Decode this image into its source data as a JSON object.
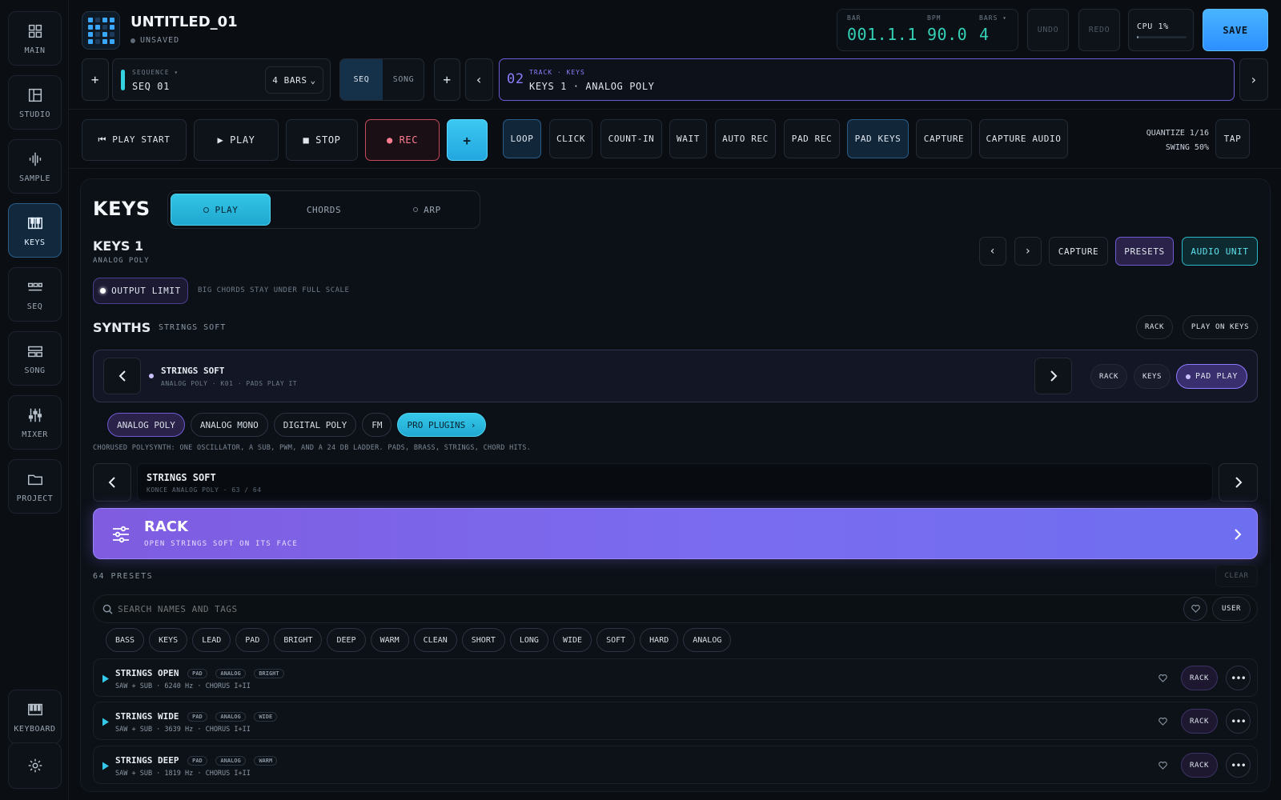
{
  "sidebar": {
    "items": [
      {
        "label": "MAIN",
        "icon": "grid-icon"
      },
      {
        "label": "STUDIO",
        "icon": "layout-icon"
      },
      {
        "label": "SAMPLE",
        "icon": "waveform-icon"
      },
      {
        "label": "KEYS",
        "icon": "piano-icon"
      },
      {
        "label": "SEQ",
        "icon": "steps-icon"
      },
      {
        "label": "SONG",
        "icon": "blocks-icon"
      },
      {
        "label": "MIXER",
        "icon": "faders-icon"
      },
      {
        "label": "PROJECT",
        "icon": "folder-icon"
      }
    ],
    "keyboard_label": "KEYBOARD",
    "active": "KEYS"
  },
  "header": {
    "project_title": "UNTITLED_01",
    "status": "UNSAVED",
    "bar_label": "BAR",
    "bar_value": "001.1.1",
    "bpm_label": "BPM",
    "bpm_value": "90.0",
    "bars_label": "BARS ▾",
    "bars_value": "4",
    "undo": "UNDO",
    "redo": "REDO",
    "cpu": "CPU 1%",
    "cpu_level": 0.01,
    "save": "SAVE"
  },
  "sequence_bar": {
    "add": "+",
    "sequence_label": "SEQUENCE ▾",
    "sequence_name": "SEQ 01",
    "length": "4 BARS",
    "mode_seq": "SEQ",
    "mode_song": "SONG",
    "add2": "+",
    "prev": "‹",
    "track_number": "02",
    "track_label": "TRACK · KEYS",
    "track_name": "KEYS 1 · ANALOG POLY",
    "next": "›"
  },
  "transport": {
    "play_start": "⏮ PLAY START",
    "play": "▶ PLAY",
    "stop": "■ STOP",
    "rec": "● REC",
    "add": "+",
    "toggles": [
      "LOOP",
      "CLICK",
      "COUNT-IN",
      "WAIT",
      "AUTO REC",
      "PAD REC",
      "PAD KEYS",
      "CAPTURE",
      "CAPTURE AUDIO"
    ],
    "quantize": "QUANTIZE 1/16",
    "swing": "SWING 50%",
    "tap": "TAP"
  },
  "keys": {
    "title": "KEYS",
    "tabs": [
      "PLAY",
      "CHORDS",
      "ARP"
    ],
    "instrument_name": "KEYS 1",
    "instrument_sub": "ANALOG POLY",
    "prev": "‹",
    "next": "›",
    "capture": "CAPTURE",
    "presets": "PRESETS",
    "audio_unit": "AUDIO UNIT",
    "output_limit": "OUTPUT LIMIT",
    "output_limit_note": "BIG CHORDS STAY UNDER FULL SCALE",
    "synths_title": "SYNTHS",
    "synths_sub": "STRINGS SOFT",
    "rack": "RACK",
    "play_on_keys": "PLAY ON KEYS",
    "slot_name": "STRINGS SOFT",
    "slot_sub": "ANALOG POLY · K01 · PADS PLAY IT",
    "slot_rack": "RACK",
    "slot_keys": "KEYS",
    "slot_pad_play": "PAD PLAY",
    "engines": [
      "ANALOG POLY",
      "ANALOG MONO",
      "DIGITAL POLY",
      "FM"
    ],
    "pro_plugins": "PRO PLUGINS ›",
    "engine_desc": "CHORUSED POLYSYNTH: ONE OSCILLATOR, A SUB, PWM, AND A 24 DB LADDER. PADS, BRASS, STRINGS, CHORD HITS.",
    "preset_name": "STRINGS SOFT",
    "preset_sub": "KONCE ANALOG POLY · 63 / 64",
    "rack_title": "RACK",
    "rack_sub": "OPEN STRINGS SOFT ON ITS FACE",
    "presets_count": "64 PRESETS",
    "clear": "CLEAR",
    "search_placeholder": "SEARCH NAMES AND TAGS",
    "user": "USER",
    "tags": [
      "BASS",
      "KEYS",
      "LEAD",
      "PAD",
      "BRIGHT",
      "DEEP",
      "WARM",
      "CLEAN",
      "SHORT",
      "LONG",
      "WIDE",
      "SOFT",
      "HARD",
      "ANALOG"
    ],
    "preset_list": [
      {
        "name": "STRINGS OPEN",
        "tags": [
          "PAD",
          "ANALOG",
          "BRIGHT"
        ],
        "detail": "SAW + SUB · 6240 Hz · CHORUS I+II",
        "rack": "RACK"
      },
      {
        "name": "STRINGS WIDE",
        "tags": [
          "PAD",
          "ANALOG",
          "WIDE"
        ],
        "detail": "SAW + SUB · 3639 Hz · CHORUS I+II",
        "rack": "RACK"
      },
      {
        "name": "STRINGS DEEP",
        "tags": [
          "PAD",
          "ANALOG",
          "WARM"
        ],
        "detail": "SAW + SUB · 1819 Hz · CHORUS I+II",
        "rack": "RACK"
      }
    ]
  },
  "colors": {
    "accent_cyan": "#34d1b8",
    "accent_blue": "#3aa8ff",
    "accent_purple": "#7f5ce0",
    "rec_red": "#e0566b"
  }
}
